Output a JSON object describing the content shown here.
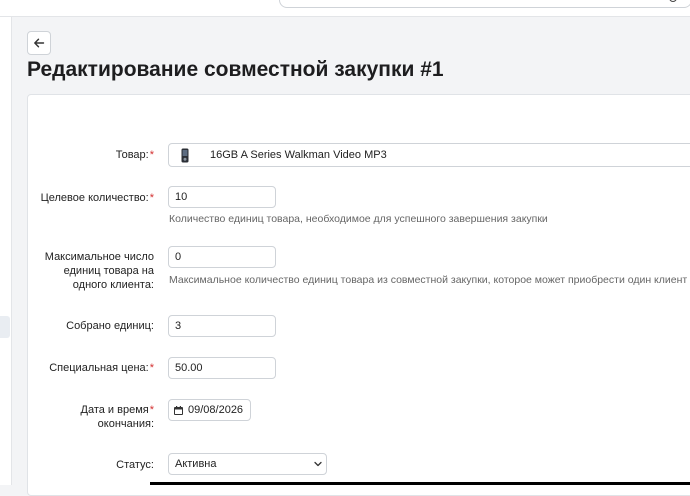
{
  "page": {
    "title": "Редактирование совместной закупки #1"
  },
  "form": {
    "product": {
      "label": "Товар:",
      "value": "16GB A Series Walkman Video MP3"
    },
    "target_qty": {
      "label": "Целевое количество:",
      "value": "10",
      "help": "Количество единиц товара, необходимое для успешного завершения закупки"
    },
    "max_per_client": {
      "label_lines": [
        "Максимальное число",
        "единиц товара на",
        "одного клиента:"
      ],
      "value": "0",
      "help": "Максимальное количество единиц товара из совместной закупки, которое может приобрести один клиент"
    },
    "collected": {
      "label": "Собрано единиц:",
      "value": "3"
    },
    "special_price": {
      "label": "Специальная цена:",
      "value": "50.00"
    },
    "end_date": {
      "label_lines": [
        "Дата и время",
        "окончания:"
      ],
      "value": "09/08/2026"
    },
    "status": {
      "label": "Статус:",
      "value": "Активна"
    }
  },
  "icons": {
    "back": "arrow-left-icon",
    "search": "search-icon",
    "calendar": "calendar-icon",
    "dropdown": "chevron-down-icon",
    "product": "mp3-player-thumbnail"
  },
  "colors": {
    "required": "#d32f2f",
    "border": "#cfd3d8",
    "page_bg": "#f3f4f6"
  }
}
